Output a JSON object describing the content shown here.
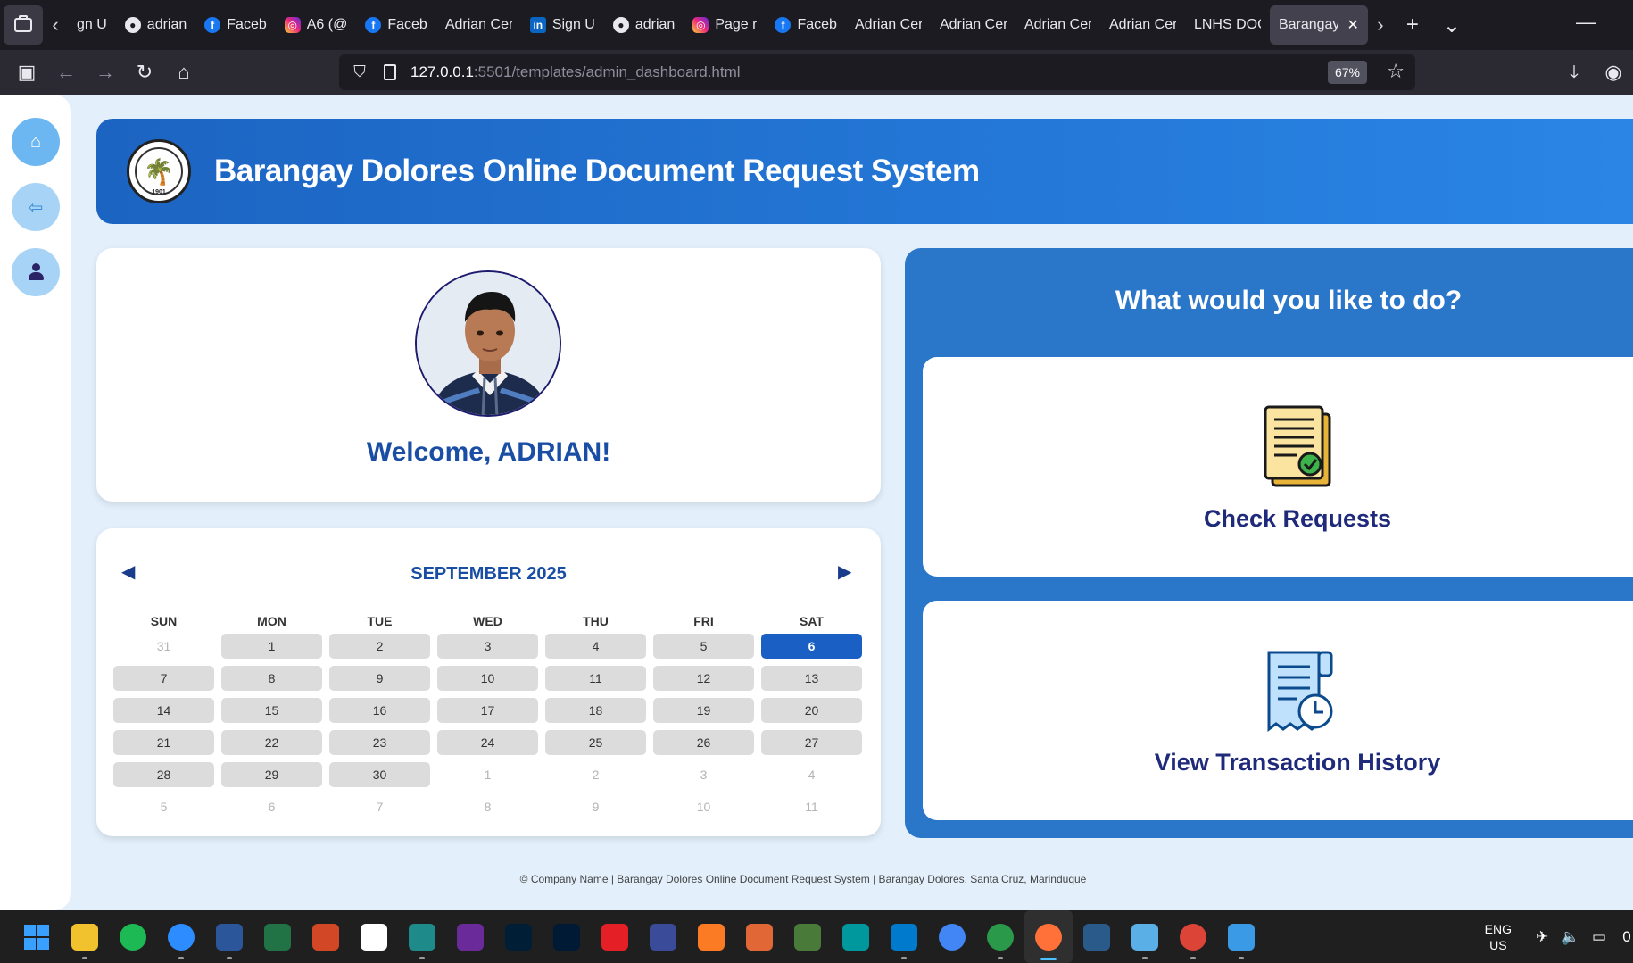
{
  "browser": {
    "tabs": [
      {
        "label": "gn U",
        "icon": ""
      },
      {
        "label": "adrian",
        "icon": "github-icon"
      },
      {
        "label": "Faceb",
        "icon": "facebook-icon"
      },
      {
        "label": "A6 (@",
        "icon": "instagram-icon"
      },
      {
        "label": "Faceb",
        "icon": "facebook-icon"
      },
      {
        "label": "Adrian Cer",
        "icon": ""
      },
      {
        "label": "Sign U",
        "icon": "linkedin-icon"
      },
      {
        "label": "adrian",
        "icon": "github-icon"
      },
      {
        "label": "Page r",
        "icon": "instagram-icon"
      },
      {
        "label": "Faceb",
        "icon": "facebook-icon"
      },
      {
        "label": "Adrian Cer",
        "icon": ""
      },
      {
        "label": "Adrian Cer",
        "icon": ""
      },
      {
        "label": "Adrian Cer",
        "icon": ""
      },
      {
        "label": "Adrian Cer",
        "icon": ""
      },
      {
        "label": "LNHS DOC",
        "icon": ""
      }
    ],
    "active_tab": "Barangay",
    "url_host": "127.0.0.1",
    "url_path": ":5501/templates/admin_dashboard.html",
    "zoom": "67%"
  },
  "header": {
    "title": "Barangay Dolores Online Document Request System",
    "seal_year": "1901"
  },
  "welcome": {
    "text": "Welcome, ADRIAN!"
  },
  "calendar": {
    "title": "SEPTEMBER 2025",
    "weekdays": [
      "SUN",
      "MON",
      "TUE",
      "WED",
      "THU",
      "FRI",
      "SAT"
    ],
    "today": "6",
    "days": [
      {
        "d": "31",
        "out": true
      },
      {
        "d": "1"
      },
      {
        "d": "2"
      },
      {
        "d": "3"
      },
      {
        "d": "4"
      },
      {
        "d": "5"
      },
      {
        "d": "6"
      },
      {
        "d": "7"
      },
      {
        "d": "8"
      },
      {
        "d": "9"
      },
      {
        "d": "10"
      },
      {
        "d": "11"
      },
      {
        "d": "12"
      },
      {
        "d": "13"
      },
      {
        "d": "14"
      },
      {
        "d": "15"
      },
      {
        "d": "16"
      },
      {
        "d": "17"
      },
      {
        "d": "18"
      },
      {
        "d": "19"
      },
      {
        "d": "20"
      },
      {
        "d": "21"
      },
      {
        "d": "22"
      },
      {
        "d": "23"
      },
      {
        "d": "24"
      },
      {
        "d": "25"
      },
      {
        "d": "26"
      },
      {
        "d": "27"
      },
      {
        "d": "28"
      },
      {
        "d": "29"
      },
      {
        "d": "30"
      },
      {
        "d": "1",
        "out": true
      },
      {
        "d": "2",
        "out": true
      },
      {
        "d": "3",
        "out": true
      },
      {
        "d": "4",
        "out": true
      },
      {
        "d": "5",
        "out": true
      },
      {
        "d": "6",
        "out": true
      },
      {
        "d": "7",
        "out": true
      },
      {
        "d": "8",
        "out": true
      },
      {
        "d": "9",
        "out": true
      },
      {
        "d": "10",
        "out": true
      },
      {
        "d": "11",
        "out": true
      }
    ]
  },
  "actions": {
    "title": "What would you like to do?",
    "check_requests": "Check Requests",
    "view_history": "View Transaction History"
  },
  "footer": {
    "text": "© Company Name | Barangay Dolores Online Document Request System | Barangay Dolores, Santa Cruz, Marinduque"
  },
  "taskbar": {
    "apps": [
      "file-explorer-icon",
      "spotify-icon",
      "zoom-icon",
      "word-icon",
      "excel-icon",
      "powerpoint-icon",
      "capcut-icon",
      "filmora-icon",
      "game-icon",
      "photoshop-icon",
      "lightroom-icon",
      "autocad-icon",
      "devc-icon",
      "xampp-icon",
      "matlab-icon",
      "proteus-icon",
      "arduino-icon",
      "vscode-icon",
      "chrome-icon",
      "cisco-packet-tracer-icon",
      "firefox-icon",
      "mysql-workbench-icon",
      "notepad-icon",
      "chrome-profile-icon",
      "photos-icon"
    ],
    "lang_top": "ENG",
    "lang_bottom": "US",
    "clock_fragment": "0"
  },
  "colors": {
    "header_start": "#1c64c2",
    "header_end": "#2a86e6",
    "panel": "#2a76c9",
    "today": "#1a5fc4",
    "title_blue": "#1a4ea4",
    "action_text": "#1f2a7a"
  }
}
